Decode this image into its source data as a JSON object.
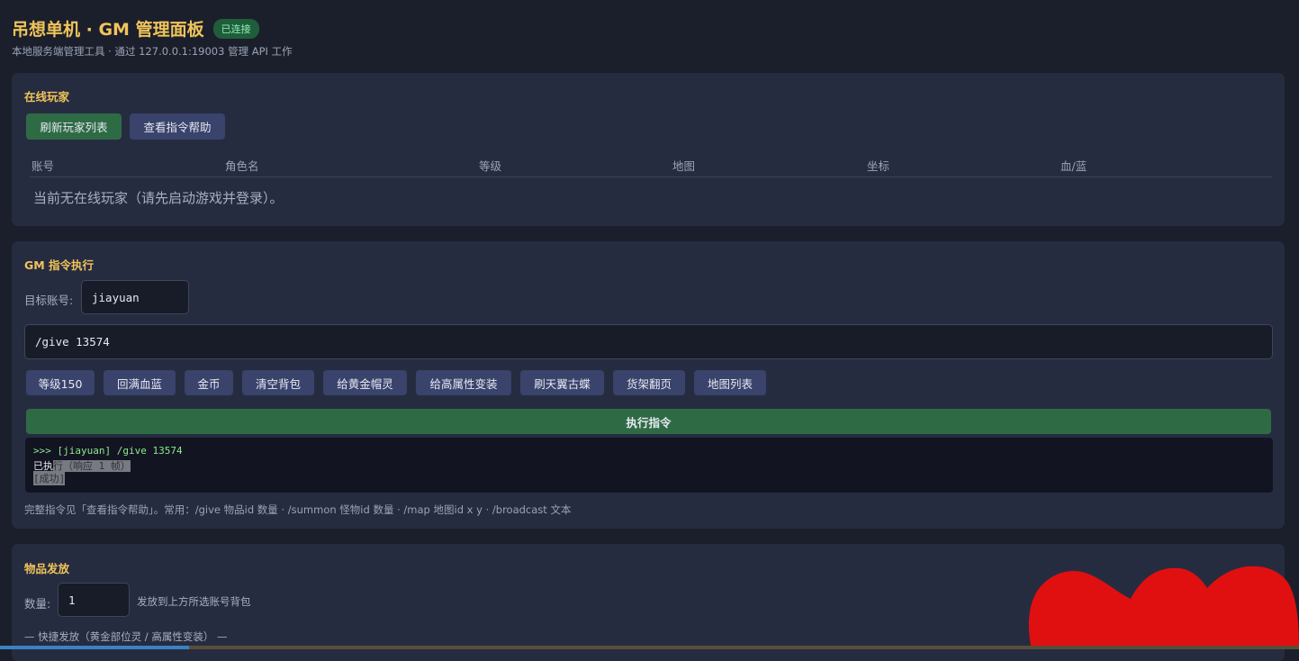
{
  "header": {
    "title": "吊想单机 · GM 管理面板",
    "badge": "已连接",
    "subtitle": "本地服务端管理工具 · 通过 127.0.0.1:19003 管理 API 工作"
  },
  "players": {
    "title": "在线玩家",
    "refresh_label": "刷新玩家列表",
    "help_label": "查看指令帮助",
    "columns": [
      "账号",
      "角色名",
      "等级",
      "地图",
      "坐标",
      "血/蓝"
    ],
    "empty_text": "当前无在线玩家（请先启动游戏并登录）。"
  },
  "gm": {
    "title": "GM 指令执行",
    "account_label": "目标账号:",
    "account_value": "jiayuan",
    "command_value": "/give 13574",
    "quick_buttons": [
      "等级150",
      "回满血蓝",
      "金币",
      "清空背包",
      "给黄金帽灵",
      "给高属性变装",
      "刷天翼古蝶",
      "货架翻页",
      "地图列表"
    ],
    "execute_label": "执行指令",
    "console": {
      "line1": ">>> [jiayuan] /give 13574",
      "line2_a": "已执",
      "line2_b": "行（响应 1 帧）",
      "line3": "[成功]"
    },
    "hint": "完整指令见「查看指令帮助」。常用：/give 物品id 数量 · /summon 怪物id 数量 · /map 地图id x y · /broadcast 文本"
  },
  "items": {
    "title": "物品发放",
    "qty_label": "数量:",
    "qty_value": "1",
    "qty_hint": "发放到上方所选账号背包",
    "quick_section": "— 快捷发放（黄金部位灵 / 高属性变装） —"
  },
  "colors": {
    "background": "#1b1f2c",
    "panel": "#262c40",
    "accent": "#f0c45a",
    "green": "#2e6b45",
    "blue_button": "#39436b",
    "redaction": "#e01010"
  }
}
